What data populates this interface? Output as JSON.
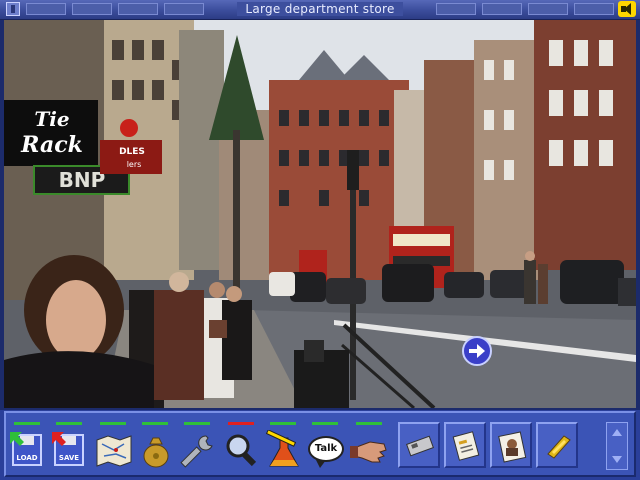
{
  "window": {
    "title": "Large department store"
  },
  "scene": {
    "signs": {
      "store_sign": "Tie Rack",
      "store_sign_line1": "Tie",
      "store_sign_line2": "Rack",
      "sign_bnp": "BNP",
      "sign_red": "DLES",
      "sign_red_sub": "lers"
    },
    "exit_arrow": {
      "direction": "right",
      "icon": "right-arrow-icon"
    }
  },
  "toolbar": {
    "load_label": "LOAD",
    "save_label": "SAVE",
    "talk_label": "Talk",
    "active_tool": "examine",
    "tools": [
      {
        "id": "load",
        "icon": "load-disk-icon"
      },
      {
        "id": "save",
        "icon": "save-disk-icon"
      },
      {
        "id": "map",
        "icon": "map-icon"
      },
      {
        "id": "money",
        "icon": "money-bag-icon"
      },
      {
        "id": "use",
        "icon": "wrench-icon"
      },
      {
        "id": "examine",
        "icon": "magnifier-icon"
      },
      {
        "id": "analyse",
        "icon": "flask-icon"
      },
      {
        "id": "talk",
        "icon": "talk-bubble-icon"
      },
      {
        "id": "take",
        "icon": "hand-icon"
      }
    ]
  },
  "inventory": {
    "items": [
      {
        "icon": "keycard-icon"
      },
      {
        "icon": "document-icon"
      },
      {
        "icon": "photo-icon"
      },
      {
        "icon": "gold-bar-icon"
      }
    ]
  },
  "colors": {
    "ui_blue": "#3b54b6",
    "indicator_green": "#2fbf3a",
    "indicator_red": "#e02020",
    "speaker_yellow": "#ffd700"
  }
}
